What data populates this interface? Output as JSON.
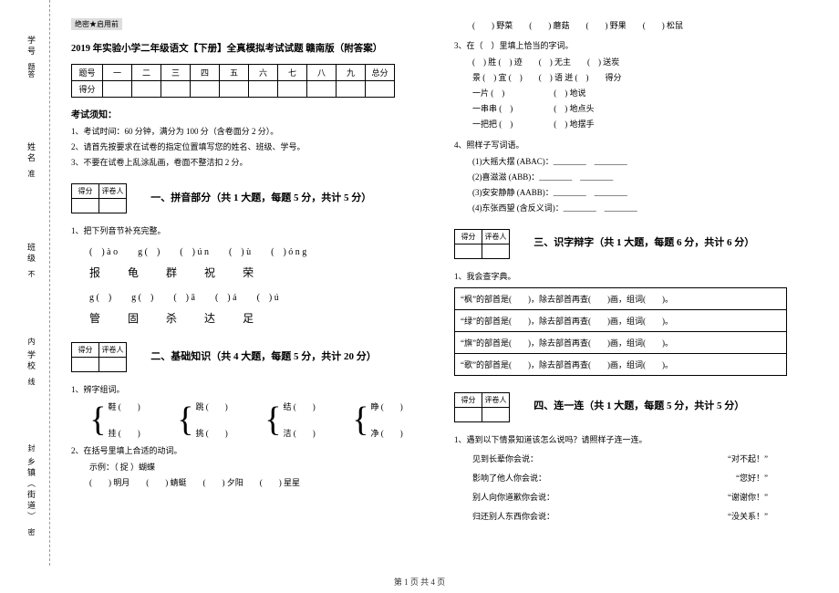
{
  "binding": {
    "labels": [
      "乡镇（街道）",
      "学校",
      "班级",
      "姓名",
      "学号"
    ],
    "marks": [
      "密",
      "封",
      "线",
      "内",
      "不",
      "准",
      "答",
      "题"
    ]
  },
  "secret": "绝密★启用前",
  "doc_title": "2019 年实验小学二年级语文【下册】全真模拟考试试题 赣南版（附答案）",
  "score_header": [
    "题号",
    "一",
    "二",
    "三",
    "四",
    "五",
    "六",
    "七",
    "八",
    "九",
    "总分"
  ],
  "score_row_label": "得分",
  "notice_head": "考试须知：",
  "notices": [
    "1、考试时间：60 分钟，满分为 100 分（含卷面分 2 分）。",
    "2、请首先按要求在试卷的指定位置填写您的姓名、班级、学号。",
    "3、不要在试卷上乱涂乱画，卷面不整洁扣 2 分。"
  ],
  "mini_box": [
    "得分",
    "评卷人"
  ],
  "sections": {
    "s1": "一、拼音部分（共 1 大题，每题 5 分，共计 5 分）",
    "s2": "二、基础知识（共 4 大题，每题 5 分，共计 20 分）",
    "s3": "三、识字辩字（共 1 大题，每题 6 分，共计 6 分）",
    "s4": "四、连一连（共 1 大题，每题 5 分，共计 5 分）"
  },
  "q1_1": "1、把下列音节补充完整。",
  "pinyin_row1": [
    "(　) à o",
    "g (　)",
    "(　) ú n",
    "(　) ù",
    "(　) ó n g"
  ],
  "hanzi_row1": [
    "报",
    "龟",
    "群",
    "祝",
    "荣"
  ],
  "pinyin_row2": [
    "g (　)",
    "g (　)",
    "(　) ā",
    "(　) á",
    "(　) ú"
  ],
  "hanzi_row2": [
    "管",
    "固",
    "杀",
    "达",
    "足"
  ],
  "q2_1": "1、辨字组词。",
  "brace_pairs": [
    {
      "top": "鞋 (　　)",
      "bot": "挂 (　　)"
    },
    {
      "top": "跳 (　　)",
      "bot": "挑 (　　)"
    },
    {
      "top": "结 (　　)",
      "bot": "洁 (　　)"
    },
    {
      "top": "睁 (　　)",
      "bot": "净 (　　)"
    }
  ],
  "q2_2": "2、在括号里填上合适的动词。",
  "q2_2_ex": "示例：（ 捉 ）蝴蝶",
  "q2_2_line": "(　　) 明月　　(　　) 蜻蜓　　(　　) 夕阳　　(　　) 星星",
  "r_line1": "(　　) 野菜　　(　　) 蘑菇　　(　　) 野果　　(　　) 松鼠",
  "q2_3": "3、在（　）里填上恰当的字词。",
  "q2_3_lines": [
    "(　) 胜 (　) 迹　　(　) 无主　　(　) 送炭",
    "景 (　) 宜 (　)　　(　) 语 迸 (　)　　得分",
    "一片 (　)　　　　　　(　) 地说",
    "一串串 (　)　　　　　(　) 地点头",
    "一把把 (　)　　　　　(　) 地摆手"
  ],
  "q2_4": "4、照样子写词语。",
  "q2_4_items": [
    "(1)大摇大摆 (ABAC)：________　________",
    "(2)喜滋滋 (ABB)：________　________",
    "(3)安安静静 (AABB)：________　________",
    "(4)东张西望 (含反义词)：________　________"
  ],
  "q3_1": "1、我会查字典。",
  "dict_rows": [
    "“枫”的部首是(　　)，除去部首再查(　　)画，组词(　　)。",
    "“绿”的部首是(　　)，除去部首再查(　　)画，组词(　　)。",
    "“旗”的部首是(　　)，除去部首再查(　　)画，组词(　　)。",
    "“歌”的部首是(　　)，除去部首再查(　　)画，组词(　　)。"
  ],
  "q4_1": "1、遇到以下情景知道该怎么说吗？请照样子连一连。",
  "match": [
    {
      "l": "见到长辈你会说：",
      "r": "“对不起！”"
    },
    {
      "l": "影响了他人你会说：",
      "r": "“您好！”"
    },
    {
      "l": "别人向你道歉你会说：",
      "r": "“谢谢你！”"
    },
    {
      "l": "归还别人东西你会说：",
      "r": "“没关系！”"
    }
  ],
  "footer": "第 1 页 共 4 页"
}
